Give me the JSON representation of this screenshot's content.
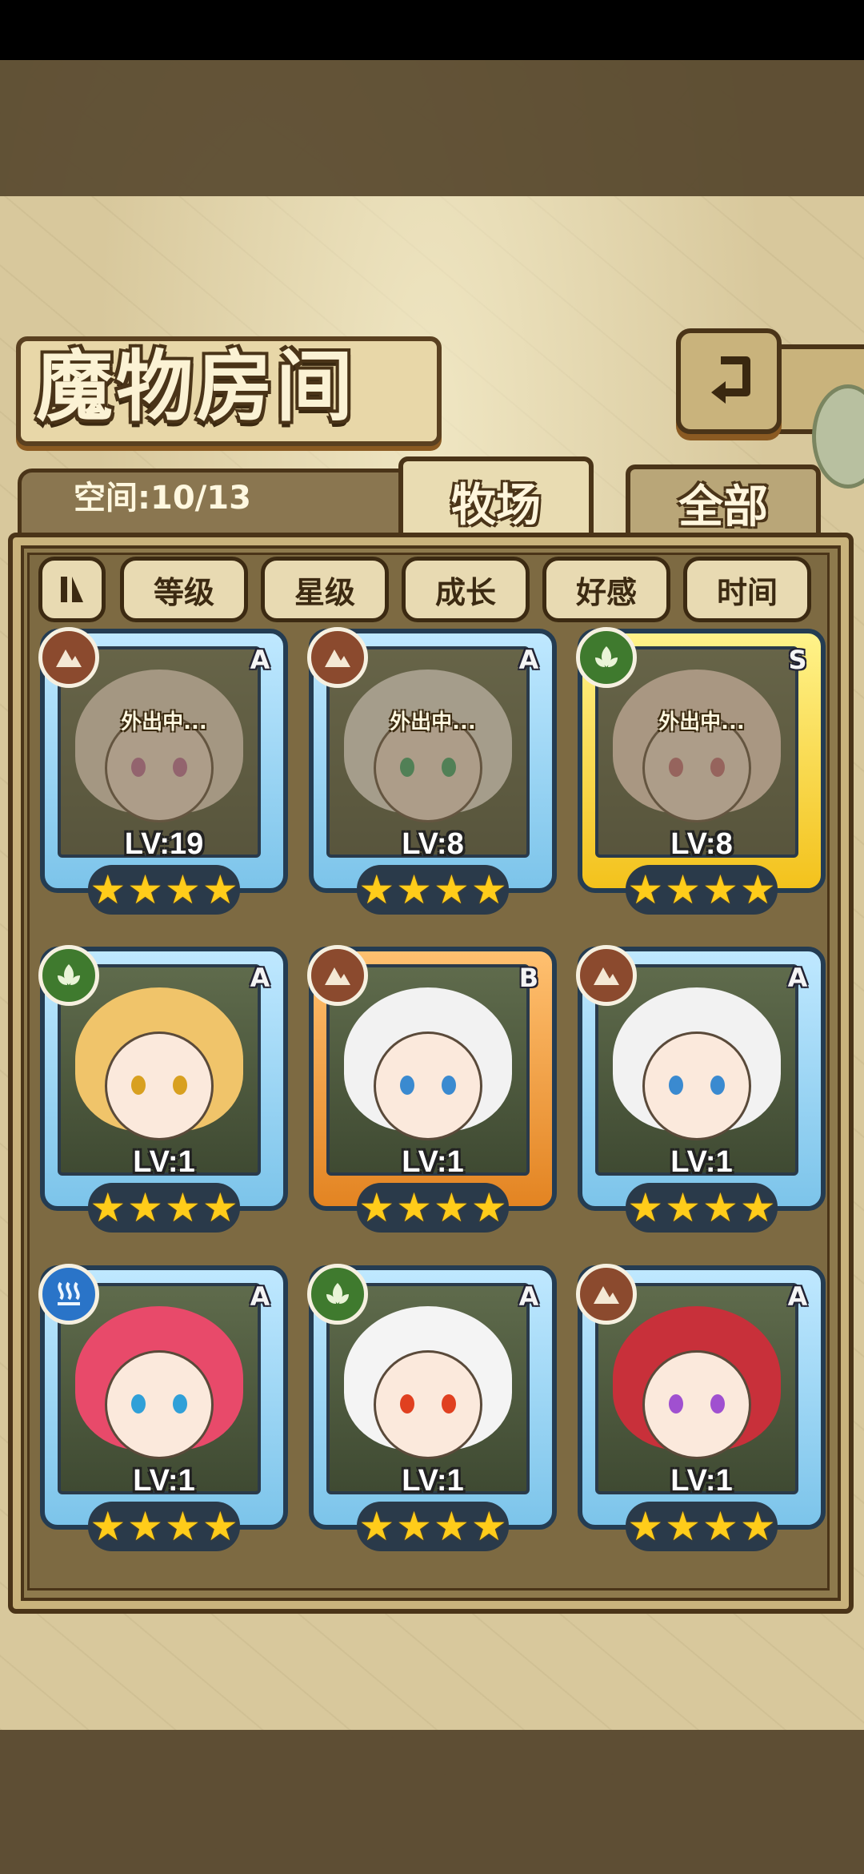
{
  "title": "魔物房间",
  "space": {
    "label": "空间:10/13"
  },
  "tabs": [
    {
      "label": "牧场",
      "active": true
    },
    {
      "label": "全部",
      "active": false
    }
  ],
  "filters": [
    "等级",
    "星级",
    "成长",
    "好感",
    "时间"
  ],
  "icons": {
    "back": "return-arrow-icon",
    "sort_toggle": "sort-toggle-icon",
    "earth": "earth-element-icon",
    "wood": "leaf-element-icon",
    "water": "water-element-icon",
    "star": "star-icon"
  },
  "colors": {
    "rank_a": "#7cc4ea",
    "rank_s": "#f3c21c",
    "rank_b": "#e38422"
  },
  "monsters": [
    {
      "rank": "A",
      "element": "earth",
      "level": "LV:19",
      "stars": 4,
      "status": "外出中..."
    },
    {
      "rank": "A",
      "element": "earth",
      "level": "LV:8",
      "stars": 4,
      "status": "外出中..."
    },
    {
      "rank": "S",
      "element": "wood",
      "level": "LV:8",
      "stars": 4,
      "status": "外出中..."
    },
    {
      "rank": "A",
      "element": "wood",
      "level": "LV:1",
      "stars": 4,
      "status": ""
    },
    {
      "rank": "B",
      "element": "earth",
      "level": "LV:1",
      "stars": 4,
      "status": ""
    },
    {
      "rank": "A",
      "element": "earth",
      "level": "LV:1",
      "stars": 4,
      "status": ""
    },
    {
      "rank": "A",
      "element": "water",
      "level": "LV:1",
      "stars": 4,
      "status": ""
    },
    {
      "rank": "A",
      "element": "wood",
      "level": "LV:1",
      "stars": 4,
      "status": ""
    },
    {
      "rank": "A",
      "element": "earth",
      "level": "LV:1",
      "stars": 4,
      "status": ""
    }
  ]
}
